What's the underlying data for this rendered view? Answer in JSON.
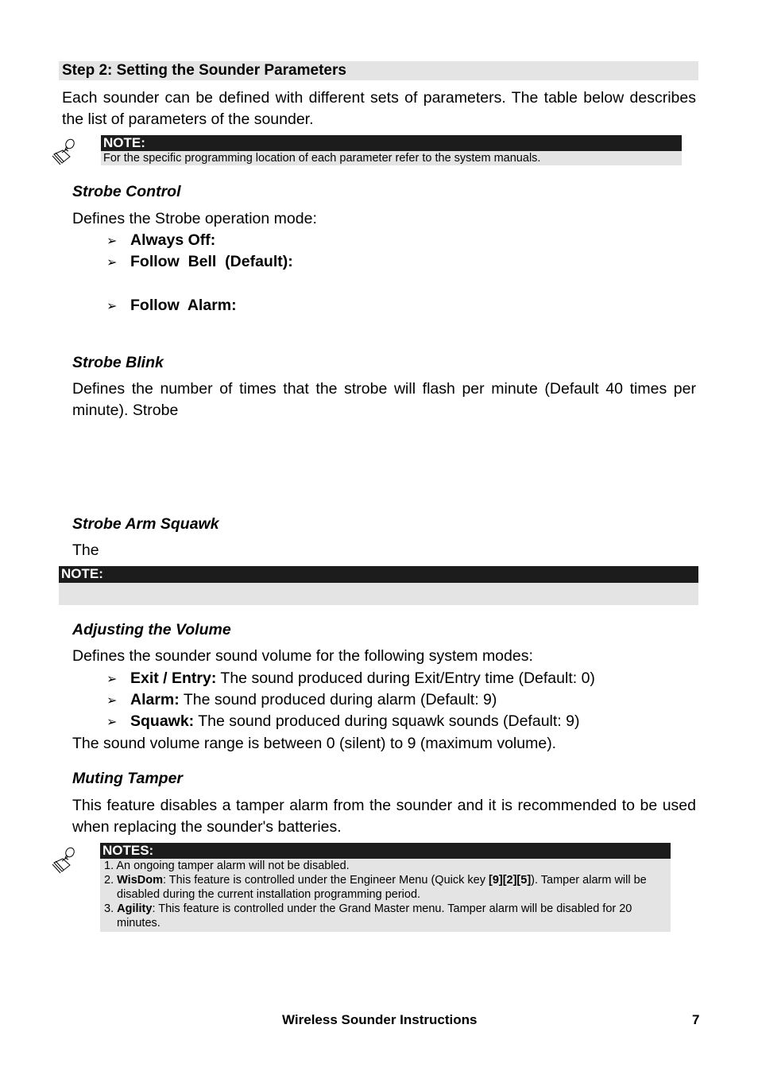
{
  "step_title": "Step 2: Setting the Sounder Parameters",
  "intro": "Each sounder can be defined with different sets of parameters. The table below describes the list of parameters of the sounder.",
  "note1": {
    "icon": "note-hand-icon",
    "label": "NOTE:",
    "text": "For the specific programming location of each parameter refer to the system manuals."
  },
  "strobe_control": {
    "heading": "Strobe Control",
    "description": "Defines the Strobe operation mode:",
    "bullet_glyph": "➢",
    "options": [
      {
        "label": "Always Off:"
      },
      {
        "label": "Follow  Bell  (Default):"
      },
      {
        "label": "Follow  Alarm:"
      }
    ]
  },
  "strobe_blink": {
    "heading": "Strobe Blink",
    "description": "Defines the number of times that the strobe will flash per minute (Default 40 times per minute). Strobe"
  },
  "strobe_arm_squawk": {
    "heading": "Strobe Arm Squawk",
    "description": "The",
    "note_label": "NOTE:"
  },
  "adjusting_volume": {
    "heading": "Adjusting the Volume",
    "description": "Defines the sounder sound volume for the following system modes:",
    "modes": [
      {
        "label": "Exit / Entry:",
        "text": " The sound produced during Exit/Entry time (Default: 0)"
      },
      {
        "label": "Alarm:",
        "text": " The sound produced during alarm (Default: 9)"
      },
      {
        "label": "Squawk:",
        "text": " The sound produced during squawk sounds (Default: 9)"
      }
    ],
    "range_text": "The sound volume range is between 0 (silent) to 9 (maximum volume)."
  },
  "muting_tamper": {
    "heading": "Muting Tamper",
    "description": "This feature disables a tamper alarm from the sounder and it is recommended to be used when replacing the sounder's batteries.",
    "notes_label": "NOTES:",
    "notes": [
      {
        "num": "1.",
        "bold": "",
        "text": " An ongoing tamper alarm will not be disabled."
      },
      {
        "num": "2.",
        "bold": "WisDom",
        "text": ": This feature is controlled under the Engineer Menu (Quick key ",
        "key": "[9][2][5]",
        "text2": "). Tamper alarm will be disabled during the current installation programming period."
      },
      {
        "num": "3.",
        "bold": "Agility",
        "text": ": This feature is controlled under the Grand Master menu. Tamper alarm will be disabled for 20 minutes."
      }
    ]
  },
  "footer": {
    "title": "Wireless Sounder Instructions",
    "page_number": "7"
  }
}
